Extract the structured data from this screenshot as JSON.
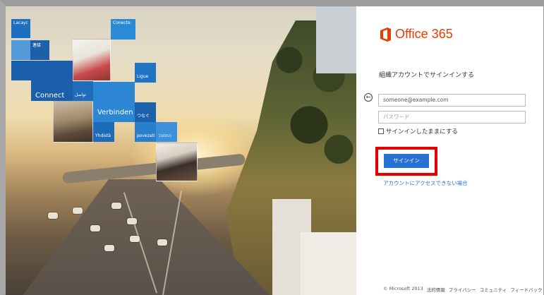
{
  "hero": {
    "tiles": {
      "lacayc": "Lacayc",
      "conecte": "Conecte",
      "kanji": "連接",
      "ligue": "Ligue",
      "connect": "Connect",
      "ar": "تواصل",
      "verbinden": "Verbinden",
      "tsunagu": "つなぐ",
      "yhdista": "Yhdistä",
      "povezati": "povezati",
      "he": "התחבר"
    }
  },
  "login": {
    "brand": "Office 365",
    "heading": "組織アカウントでサインインする",
    "email_placeholder": "someone@example.com",
    "password_placeholder": "パスワード",
    "stay_signed_in": "サインインしたままにする",
    "signin_label": "サインイン",
    "cant_access": "アカウントにアクセスできない場合"
  },
  "footer": {
    "copyright": "© Microsoft 2013",
    "legal": "法的情報",
    "privacy": "プライバシー",
    "community": "コミュニティ",
    "feedback": "フィードバック"
  },
  "colors": {
    "brand": "#eb3c00",
    "button": "#2772d2",
    "highlight": "#e60000",
    "link": "#2f6fc6"
  }
}
